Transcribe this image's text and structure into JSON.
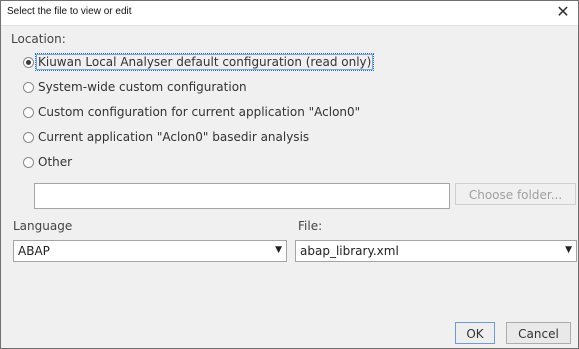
{
  "window": {
    "title": "Select the file to view or edit",
    "close_glyph": "✕"
  },
  "location_label": "Location:",
  "options": [
    {
      "label": "Kiuwan Local Analyser default configuration (read only)",
      "checked": true
    },
    {
      "label": "System-wide custom configuration",
      "checked": false
    },
    {
      "label": "Custom configuration for current application \"Aclon0\"",
      "checked": false
    },
    {
      "label": "Current application \"Aclon0\" basedir analysis",
      "checked": false
    },
    {
      "label": "Other",
      "checked": false
    }
  ],
  "other_path": {
    "value": "",
    "placeholder": ""
  },
  "choose_folder_label": "Choose folder...",
  "language": {
    "label": "Language",
    "selected": "ABAP"
  },
  "file": {
    "label": "File:",
    "selected": "abap_library.xml"
  },
  "buttons": {
    "ok": "OK",
    "cancel": "Cancel"
  },
  "icons": {
    "dropdown_arrow": "▼"
  }
}
